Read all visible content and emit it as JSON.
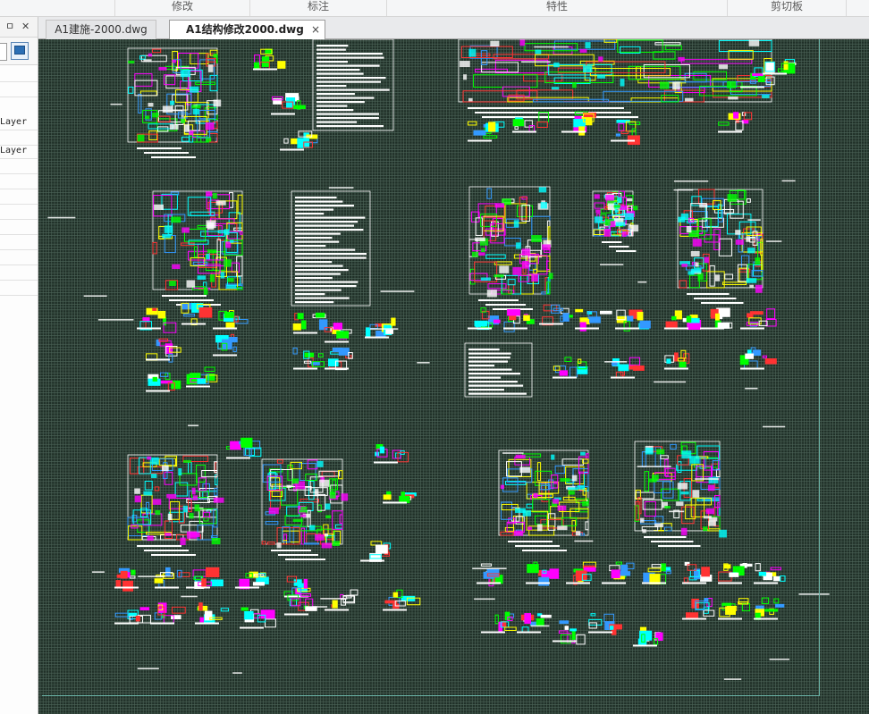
{
  "ribbon": {
    "groups": [
      {
        "label": "修改"
      },
      {
        "label": "标注"
      },
      {
        "label": "特性"
      },
      {
        "label": "剪切板"
      }
    ]
  },
  "left_panel": {
    "pin_glyph": "ㅁ",
    "close_glyph": "✕",
    "rows": [
      "Layer",
      "Layer"
    ]
  },
  "tabs": [
    {
      "label": "A1建施-2000.dwg",
      "active": false
    },
    {
      "label": "A1结构修改2000.dwg",
      "active": true,
      "close": "×"
    }
  ],
  "drawing": {
    "background": "#203028",
    "grid_color": "#5f7a6c",
    "palette": [
      "#00ffff",
      "#ff00ff",
      "#ffffff",
      "#00ff00",
      "#ffff00",
      "#ff3333",
      "#3399ff"
    ]
  }
}
